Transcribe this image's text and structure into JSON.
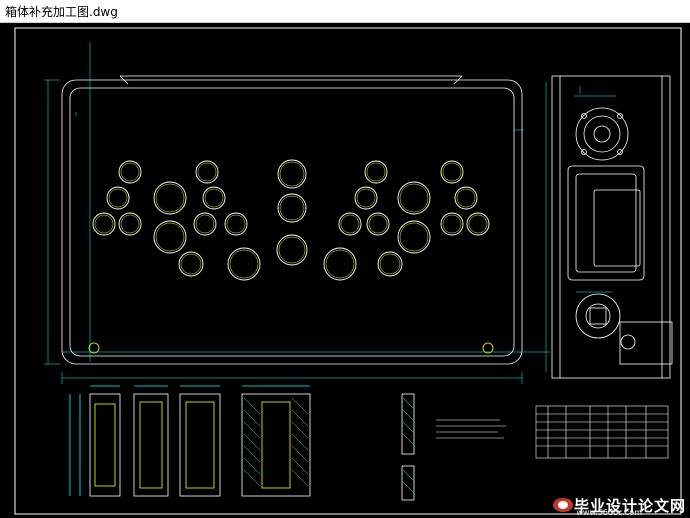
{
  "window": {
    "title": "箱体补充加工图.dwg"
  },
  "drawing": {
    "background": "#000000",
    "line_color": "#ffffff",
    "dim_color": "#00ffff",
    "accent_color": "#ffff00",
    "button_holes": 24
  },
  "watermark": {
    "name": "毕业设计论文网",
    "url": "www.56doc.com"
  }
}
